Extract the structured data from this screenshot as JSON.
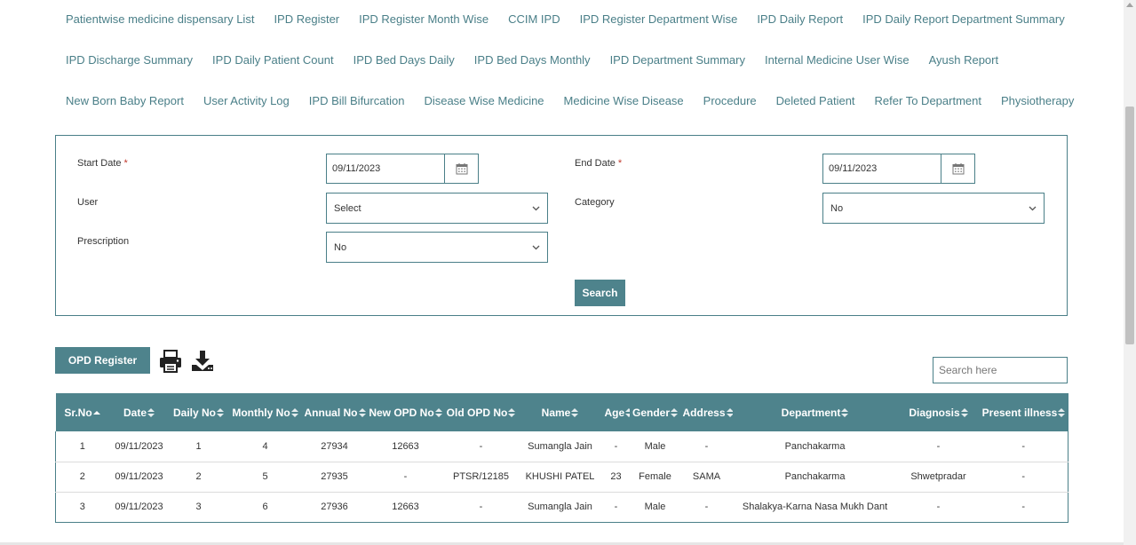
{
  "nav": {
    "row1": [
      "Patientwise medicine dispensary List",
      "IPD Register",
      "IPD Register Month Wise",
      "CCIM IPD",
      "IPD Register Department Wise",
      "IPD Daily Report",
      "IPD Daily Report Department Summary"
    ],
    "row2": [
      "IPD Discharge Summary",
      "IPD Daily Patient Count",
      "IPD Bed Days Daily",
      "IPD Bed Days Monthly",
      "IPD Department Summary",
      "Internal Medicine User Wise",
      "Ayush Report"
    ],
    "row3": [
      "New Born Baby Report",
      "User Activity Log",
      "IPD Bill Bifurcation",
      "Disease Wise Medicine",
      "Medicine Wise Disease",
      "Procedure",
      "Deleted Patient",
      "Refer To Department",
      "Physiotherapy"
    ]
  },
  "filters": {
    "start_date_label": "Start Date",
    "start_date_value": "09/11/2023",
    "end_date_label": "End Date",
    "end_date_value": "09/11/2023",
    "required_mark": "*",
    "user_label": "User",
    "user_value": "Select",
    "category_label": "Category",
    "category_value": "No",
    "prescription_label": "Prescription",
    "prescription_value": "No",
    "search_button": "Search"
  },
  "toolbar": {
    "opd_register_button": "OPD Register",
    "search_placeholder": "Search here"
  },
  "table": {
    "columns": [
      "Sr.No",
      "Date",
      "Daily No",
      "Monthly No",
      "Annual No",
      "New OPD No",
      "Old OPD No",
      "Name",
      "Age",
      "Gender",
      "Address",
      "Department",
      "Diagnosis",
      "Present illness"
    ],
    "rows": [
      [
        "1",
        "09/11/2023",
        "1",
        "4",
        "27934",
        "12663",
        "-",
        "Sumangla Jain",
        "-",
        "Male",
        "-",
        "Panchakarma",
        "-",
        "-"
      ],
      [
        "2",
        "09/11/2023",
        "2",
        "5",
        "27935",
        "-",
        "PTSR/12185",
        "KHUSHI PATEL",
        "23",
        "Female",
        "SAMA",
        "Panchakarma",
        "Shwetpradar",
        "-"
      ],
      [
        "3",
        "09/11/2023",
        "3",
        "6",
        "27936",
        "12663",
        "-",
        "Sumangla Jain",
        "-",
        "Male",
        "-",
        "Shalakya-Karna Nasa Mukh Dant",
        "-",
        "-"
      ]
    ]
  },
  "colors": {
    "accent": "#4e838c",
    "link": "#4a7f88"
  }
}
